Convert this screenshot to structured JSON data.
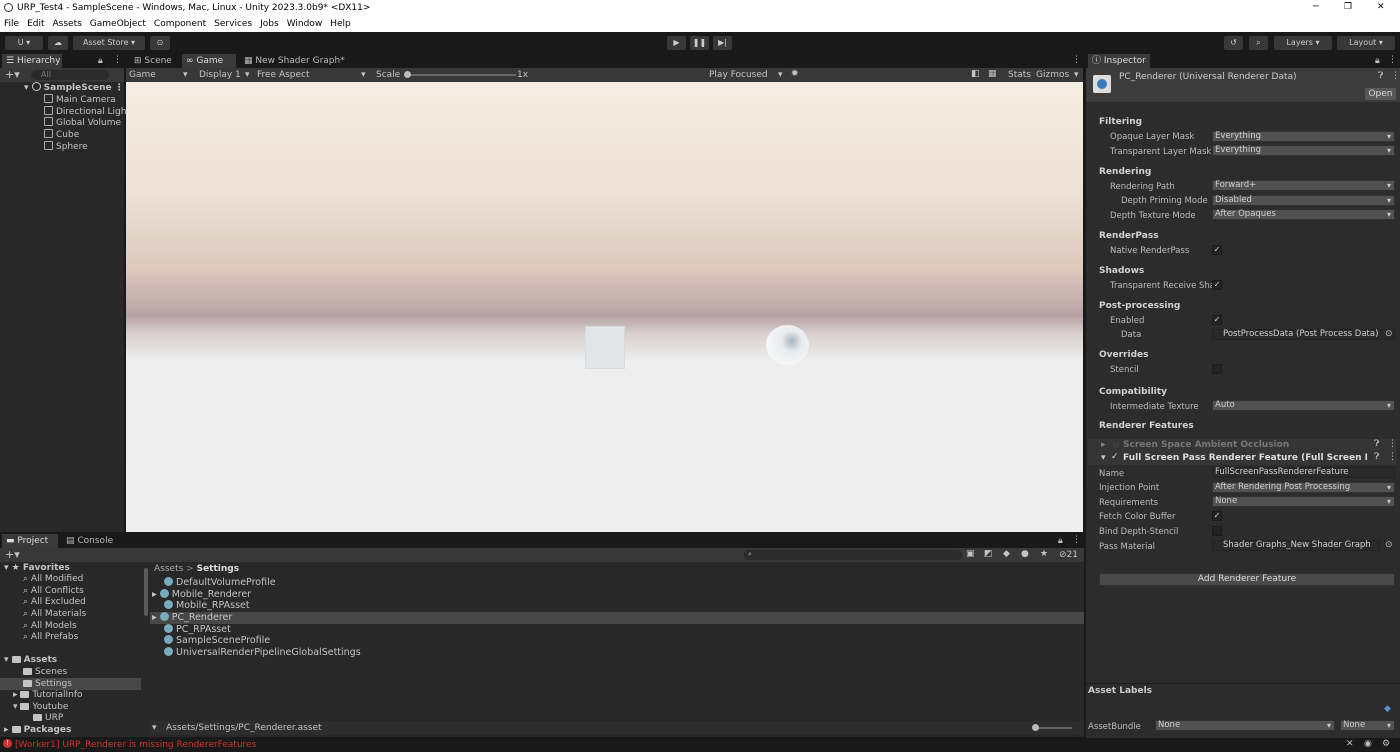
{
  "window": {
    "title": "URP_Test4 - SampleScene - Windows, Mac, Linux - Unity 2023.3.0b9* <DX11>",
    "minimize": "─",
    "maximize": "❐",
    "close": "✕"
  },
  "menu": [
    "File",
    "Edit",
    "Assets",
    "GameObject",
    "Component",
    "Services",
    "Jobs",
    "Window",
    "Help"
  ],
  "toolbar": {
    "account": "U ▾",
    "asset_store": "Asset Store ▾",
    "layers": "Layers",
    "layout": "Layout"
  },
  "hierarchy": {
    "tab": "Hierarchy",
    "search_placeholder": "All",
    "scene": "SampleScene",
    "items": [
      "Main Camera",
      "Directional Light",
      "Global Volume",
      "Cube",
      "Sphere"
    ]
  },
  "center_tabs": {
    "scene": "Scene",
    "game": "Game",
    "shader": "New Shader Graph*"
  },
  "game_bar": {
    "mode": "Game",
    "display": "Display 1",
    "aspect": "Free Aspect",
    "scale_label": "Scale",
    "scale_value": "1x",
    "play": "Play Focused",
    "stats": "Stats",
    "gizmos": "Gizmos"
  },
  "project": {
    "tab_project": "Project",
    "tab_console": "Console",
    "breadcrumb_root": "Assets",
    "breadcrumb_sep": ">",
    "breadcrumb_current": "Settings",
    "count": "21",
    "favorites_label": "Favorites",
    "favorites": [
      "All Modified",
      "All Conflicts",
      "All Excluded",
      "All Materials",
      "All Models",
      "All Prefabs"
    ],
    "assets_label": "Assets",
    "folders": [
      "Scenes",
      "Settings",
      "TutorialInfo",
      "Youtube",
      "URP"
    ],
    "packages_label": "Packages",
    "files": [
      "DefaultVolumeProfile",
      "Mobile_Renderer",
      "Mobile_RPAsset",
      "PC_Renderer",
      "PC_RPAsset",
      "SampleSceneProfile",
      "UniversalRenderPipelineGlobalSettings"
    ],
    "path": "Assets/Settings/PC_Renderer.asset"
  },
  "status": {
    "error": "[Worker1] URP_Renderer is missing RendererFeatures"
  },
  "inspector": {
    "tab": "Inspector",
    "title": "PC_Renderer (Universal Renderer Data)",
    "open": "Open",
    "filtering": "Filtering",
    "opaque_label": "Opaque Layer Mask",
    "opaque_value": "Everything",
    "transparent_label": "Transparent Layer Mask",
    "transparent_value": "Everything",
    "rendering": "Rendering",
    "path_label": "Rendering Path",
    "path_value": "Forward+",
    "depth_priming_label": "Depth Priming Mode",
    "depth_priming_value": "Disabled",
    "depth_texture_label": "Depth Texture Mode",
    "depth_texture_value": "After Opaques",
    "renderpass": "RenderPass",
    "native_label": "Native RenderPass",
    "shadows": "Shadows",
    "trs_label": "Transparent Receive Sha",
    "post": "Post-processing",
    "enabled_label": "Enabled",
    "data_label": "Data",
    "data_value": "PostProcessData (Post Process Data)",
    "overrides": "Overrides",
    "stencil_label": "Stencil",
    "compat": "Compatibility",
    "intermediate_label": "Intermediate Texture",
    "intermediate_value": "Auto",
    "features": "Renderer Features",
    "ssao": "Screen Space Ambient Occlusion",
    "fullscreen": "Full Screen Pass Renderer Feature (Full Screen Pass",
    "name_label": "Name",
    "name_value": "FullScreenPassRendererFeature",
    "injection_label": "Injection Point",
    "injection_value": "After Rendering Post Processing",
    "req_label": "Requirements",
    "req_value": "None",
    "fetch_label": "Fetch Color Buffer",
    "bind_label": "Bind Depth-Stencil",
    "pass_label": "Pass Material",
    "pass_value": "Shader Graphs_New Shader Graph",
    "add_feature": "Add Renderer Feature",
    "asset_labels": "Asset Labels",
    "bundle_label": "AssetBundle",
    "bundle_value": "None",
    "variant_value": "None"
  },
  "colors": {
    "accent": "#3a79bb",
    "error": "#d33030",
    "panel": "#282828"
  }
}
